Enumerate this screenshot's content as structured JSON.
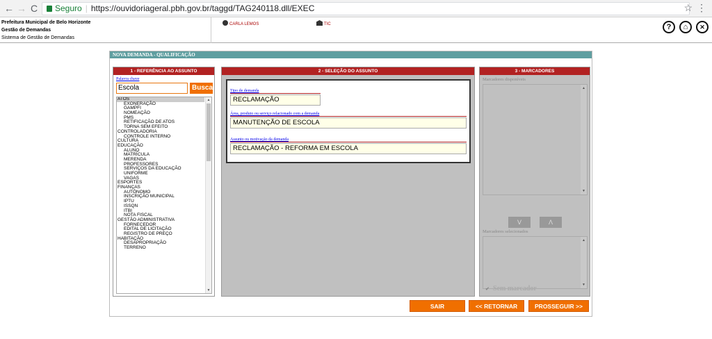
{
  "browser": {
    "secure_label": "Seguro",
    "url": "https://ouvidoriageral.pbh.gov.br/taggd/TAG240118.dll/EXEC"
  },
  "header": {
    "org_name": "Prefeitura Municipal de Belo Horizonte",
    "module": "Gestão de Demandas",
    "system": "Sistema de Gestão de Demandas",
    "user": "CARLA LEMOS",
    "org_unit": "TIC",
    "help_label": "?",
    "home_label": "⌂",
    "close_label": "✕"
  },
  "dialog": {
    "title": "NOVA DEMANDA - QUALIFICAÇÃO",
    "panel1": {
      "title": "1 - REFERÊNCIA AO ASSUNTO",
      "keyword_label": "Palavra chave",
      "keyword_value": "Escola",
      "search_button": "Busca",
      "tree": [
        {
          "label": "ATOS",
          "level": 0,
          "selected": true
        },
        {
          "label": "EXONERAÇÃO",
          "level": 1
        },
        {
          "label": "GAMPFI",
          "level": 1
        },
        {
          "label": "NOMEAÇÃO",
          "level": 1
        },
        {
          "label": "PMS",
          "level": 1
        },
        {
          "label": "RETIFICAÇÃO DE ATOS",
          "level": 1
        },
        {
          "label": "TORNA SEM EFEITO",
          "level": 1
        },
        {
          "label": "CONTROLADORIA",
          "level": 0
        },
        {
          "label": "CONTROLE INTERNO",
          "level": 1
        },
        {
          "label": "CULTURA",
          "level": 0
        },
        {
          "label": "EDUCAÇÃO",
          "level": 0
        },
        {
          "label": "ALUNO",
          "level": 1
        },
        {
          "label": "MATRÍCULA",
          "level": 1
        },
        {
          "label": "MERENDA",
          "level": 1
        },
        {
          "label": "PROFESSORES",
          "level": 1
        },
        {
          "label": "SERVIÇOS DA EDUCAÇÃO",
          "level": 1
        },
        {
          "label": "UNIFORME",
          "level": 1
        },
        {
          "label": "VAGAS",
          "level": 1
        },
        {
          "label": "ESPORTES",
          "level": 0
        },
        {
          "label": "FINANÇAS",
          "level": 0
        },
        {
          "label": "AUTÔNOMO",
          "level": 1
        },
        {
          "label": "INSCRIÇÃO MUNICIPAL",
          "level": 1
        },
        {
          "label": "IPTU",
          "level": 1
        },
        {
          "label": "ISSQN",
          "level": 1
        },
        {
          "label": "ITBI",
          "level": 1
        },
        {
          "label": "NOTA FISCAL",
          "level": 1
        },
        {
          "label": "GESTÃO ADMINISTRATIVA",
          "level": 0
        },
        {
          "label": "FORNECEDOR",
          "level": 1
        },
        {
          "label": "EDITAL DE LICITAÇÃO",
          "level": 1
        },
        {
          "label": "REGISTRO DE PREÇO",
          "level": 1
        },
        {
          "label": "HABITAÇÃO",
          "level": 0
        },
        {
          "label": "DESAPROPRIAÇÃO",
          "level": 1
        },
        {
          "label": "TERRENO",
          "level": 1
        }
      ]
    },
    "panel2": {
      "title": "2 - SELEÇÃO DO ASSUNTO",
      "demand_type_label": "Tipo de demanda",
      "demand_type_value": "RECLAMAÇÃO",
      "area_label": "Área, produto ou serviço relacionado com a demanda",
      "area_value": "MANUTENÇÃO DE ESCOLA",
      "subject_label": "Assunto ou motivação da demanda",
      "subject_value": "RECLAMAÇÃO - REFORMA EM ESCOLA"
    },
    "panel3": {
      "title": "3 - MARCADORES",
      "available_label": "Marcadores disponíveis",
      "selected_label": "Marcadores selecionados",
      "down_label": "V",
      "up_label": "Λ",
      "no_marker_label": "Sem marcador"
    },
    "buttons": {
      "exit": "SAIR",
      "back": "<< RETORNAR",
      "next": "PROSSEGUIR >>"
    }
  }
}
